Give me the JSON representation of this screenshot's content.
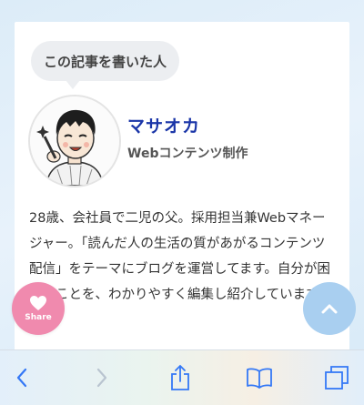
{
  "author_box": {
    "heading": "この記事を書いた人",
    "name": "マサオカ",
    "role": "Webコンテンツ制作",
    "bio": "28歳、会社員で二児の父。採用担当兼Webマネージャー。「読んだ人の生活の質があがるコンテンツ配信」をテーマにブログを運営してます。自分が困ったことを、わかりやすく編集し紹介しています。"
  },
  "floating": {
    "share_label": "Share"
  },
  "colors": {
    "name_link": "#1a35a8",
    "share_button": "#f08aae",
    "top_button": "#a9cff0",
    "toolbar_icon": "#3478f6"
  },
  "toolbar": {
    "icons": [
      "back-icon",
      "forward-icon",
      "share-icon",
      "bookmarks-icon",
      "tabs-icon"
    ]
  }
}
